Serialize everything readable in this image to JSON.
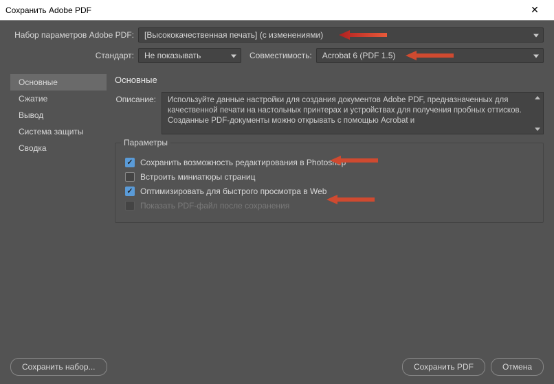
{
  "titlebar": {
    "title": "Сохранить Adobe PDF"
  },
  "top": {
    "preset_label": "Набор параметров Adobe PDF:",
    "preset_value": "[Высококачественная печать] (с изменениями)",
    "standard_label": "Стандарт:",
    "standard_value": "Не показывать",
    "compat_label": "Совместимость:",
    "compat_value": "Acrobat 6 (PDF 1.5)"
  },
  "sidebar": {
    "items": [
      {
        "label": "Основные",
        "active": true
      },
      {
        "label": "Сжатие",
        "active": false
      },
      {
        "label": "Вывод",
        "active": false
      },
      {
        "label": "Система защиты",
        "active": false
      },
      {
        "label": "Сводка",
        "active": false
      }
    ]
  },
  "content": {
    "section_title": "Основные",
    "desc_label": "Описание:",
    "desc_text": "Используйте данные настройки для создания документов Adobe PDF, предназначенных для качественной печати на настольных принтерах и устройствах для получения пробных оттисков. Созданные PDF-документы можно  открывать с помощью Acrobat и",
    "params_legend": "Параметры",
    "checks": [
      {
        "label": "Сохранить возможность редактирования в Photoshop",
        "checked": true,
        "disabled": false
      },
      {
        "label": "Встроить миниатюры страниц",
        "checked": false,
        "disabled": false
      },
      {
        "label": "Оптимизировать для быстрого просмотра в Web",
        "checked": true,
        "disabled": false
      },
      {
        "label": "Показать PDF-файл после сохранения",
        "checked": false,
        "disabled": true
      }
    ]
  },
  "footer": {
    "save_preset": "Сохранить набор...",
    "save_pdf": "Сохранить PDF",
    "cancel": "Отмена"
  }
}
